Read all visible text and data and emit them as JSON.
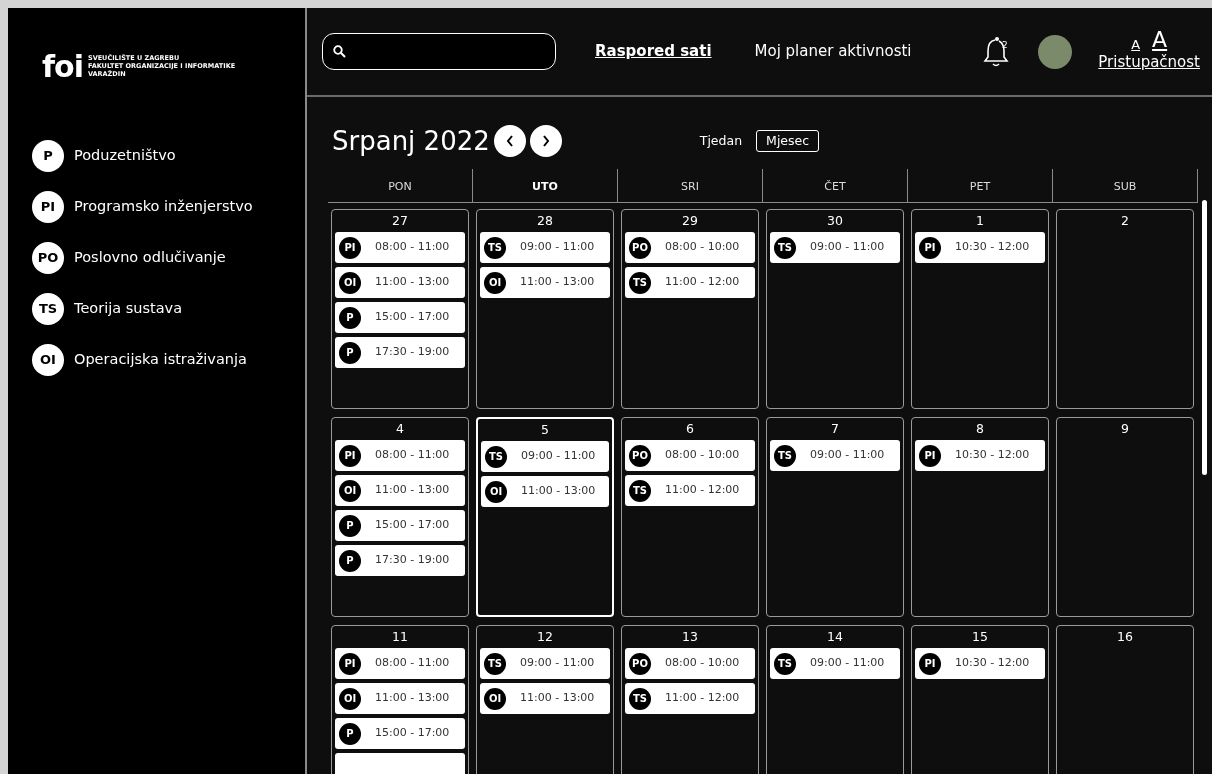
{
  "sidebar": {
    "logo": {
      "mark": "foi",
      "lines": [
        "SVEUČILIŠTE U ZAGREBU",
        "FAKULTET ORGANIZACIJE I INFORMATIKE",
        "VARAŽDIN"
      ]
    },
    "courses": [
      {
        "code": "P",
        "name": "Poduzetništvo"
      },
      {
        "code": "PI",
        "name": "Programsko inženjerstvo"
      },
      {
        "code": "PO",
        "name": "Poslovno odlučivanje"
      },
      {
        "code": "TS",
        "name": "Teorija sustava"
      },
      {
        "code": "OI",
        "name": "Operacijska istraživanja"
      }
    ]
  },
  "header": {
    "nav": [
      {
        "label": "Raspored sati",
        "selected": true
      },
      {
        "label": "Moj planer aktivnosti",
        "selected": false
      }
    ],
    "notifications": {
      "count": "2"
    },
    "accessibility": {
      "small": "A",
      "large": "A",
      "label": "Pristupačnost"
    }
  },
  "calendar": {
    "title": "Srpanj 2022",
    "views": [
      {
        "label": "Tjedan",
        "selected": false
      },
      {
        "label": "Mjesec",
        "selected": true
      }
    ],
    "weekdays": [
      {
        "label": "PON",
        "selected": false
      },
      {
        "label": "UTO",
        "selected": true
      },
      {
        "label": "SRI",
        "selected": false
      },
      {
        "label": "ČET",
        "selected": false
      },
      {
        "label": "PET",
        "selected": false
      },
      {
        "label": "SUB",
        "selected": false
      }
    ],
    "weeks": [
      [
        {
          "day": "27",
          "today": false,
          "events": [
            {
              "code": "PI",
              "time": "08:00 - 11:00"
            },
            {
              "code": "OI",
              "time": "11:00 - 13:00"
            },
            {
              "code": "P",
              "time": "15:00 - 17:00"
            },
            {
              "code": "P",
              "time": "17:30 - 19:00"
            }
          ]
        },
        {
          "day": "28",
          "today": false,
          "events": [
            {
              "code": "TS",
              "time": "09:00 - 11:00"
            },
            {
              "code": "OI",
              "time": "11:00 - 13:00"
            }
          ]
        },
        {
          "day": "29",
          "today": false,
          "events": [
            {
              "code": "PO",
              "time": "08:00 - 10:00"
            },
            {
              "code": "TS",
              "time": "11:00 - 12:00"
            }
          ]
        },
        {
          "day": "30",
          "today": false,
          "events": [
            {
              "code": "TS",
              "time": "09:00 - 11:00"
            }
          ]
        },
        {
          "day": "1",
          "today": false,
          "events": [
            {
              "code": "PI",
              "time": "10:30 - 12:00"
            }
          ]
        },
        {
          "day": "2",
          "today": false
        }
      ],
      [
        {
          "day": "4",
          "today": false,
          "events": [
            {
              "code": "PI",
              "time": "08:00 - 11:00"
            },
            {
              "code": "OI",
              "time": "11:00 - 13:00"
            },
            {
              "code": "P",
              "time": "15:00 - 17:00"
            },
            {
              "code": "P",
              "time": "17:30 - 19:00"
            }
          ]
        },
        {
          "day": "5",
          "today": true,
          "events": [
            {
              "code": "TS",
              "time": "09:00 - 11:00"
            },
            {
              "code": "OI",
              "time": "11:00 - 13:00"
            }
          ]
        },
        {
          "day": "6",
          "today": false,
          "events": [
            {
              "code": "PO",
              "time": "08:00 - 10:00"
            },
            {
              "code": "TS",
              "time": "11:00 - 12:00"
            }
          ]
        },
        {
          "day": "7",
          "today": false,
          "events": [
            {
              "code": "TS",
              "time": "09:00 - 11:00"
            }
          ]
        },
        {
          "day": "8",
          "today": false,
          "events": [
            {
              "code": "PI",
              "time": "10:30 - 12:00"
            }
          ]
        },
        {
          "day": "9",
          "today": false
        }
      ],
      [
        {
          "day": "11",
          "today": false,
          "events": [
            {
              "kind": "lesson",
              "code": "PI",
              "time": "08:00 - 11:00"
            },
            {
              "kind": "lesson",
              "code": "OI",
              "time": "11:00 - 13:00"
            },
            {
              "kind": "lesson",
              "code": "P",
              "time": "15:00 - 17:00"
            },
            {
              "kind": "hidden"
            }
          ]
        },
        {
          "day": "12",
          "today": false,
          "events": [
            {
              "code": "TS",
              "time": "09:00 - 11:00"
            },
            {
              "code": "OI",
              "time": "11:00 - 13:00"
            }
          ]
        },
        {
          "day": "13",
          "today": false,
          "events": [
            {
              "code": "PO",
              "time": "08:00 - 10:00"
            },
            {
              "code": "TS",
              "time": "11:00 - 12:00"
            }
          ]
        },
        {
          "day": "14",
          "today": false,
          "events": [
            {
              "code": "TS",
              "time": "09:00 - 11:00"
            }
          ]
        },
        {
          "day": "15",
          "today": false,
          "events": [
            {
              "code": "PI",
              "time": "10:30 - 12:00"
            }
          ]
        },
        {
          "day": "16",
          "today": false
        }
      ]
    ]
  }
}
